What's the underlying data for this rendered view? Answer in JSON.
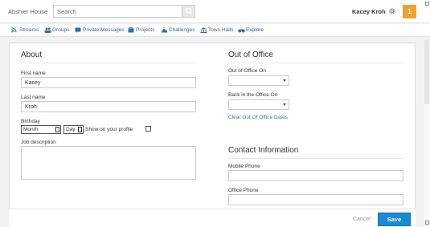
{
  "topbar": {
    "brand": "Abshier House",
    "search_placeholder": "Search",
    "user_name": "Kacey Kroh",
    "notification_count": "1"
  },
  "nav": {
    "items": [
      {
        "label": "Streams",
        "icon": "streams-icon"
      },
      {
        "label": "Groups",
        "icon": "groups-icon"
      },
      {
        "label": "Private Messages",
        "icon": "message-icon"
      },
      {
        "label": "Projects",
        "icon": "projects-icon"
      },
      {
        "label": "Challenges",
        "icon": "challenges-icon"
      },
      {
        "label": "Town Halls",
        "icon": "town-hall-icon"
      },
      {
        "label": "Explore",
        "icon": "binoculars-icon"
      }
    ]
  },
  "about": {
    "title": "About",
    "first_name_label": "First name",
    "first_name_value": "Kacey",
    "last_name_label": "Last name",
    "last_name_value": "Kroh",
    "birthday_label": "Birthday",
    "month_value": "Month",
    "day_value": "Day",
    "show_on_profile_label": "Show on your profile",
    "job_description_label": "Job description"
  },
  "out_of_office": {
    "title": "Out of Office",
    "on_label": "Out of Office On",
    "back_label": "Back in the Office On",
    "clear_link": "Clear Out Of Office Dates"
  },
  "contact": {
    "title": "Contact Information",
    "mobile_label": "Mobile Phone",
    "office_label": "Office Phone"
  },
  "footer": {
    "cancel_label": "Cancel",
    "save_label": "Save"
  },
  "colors": {
    "accent": "#1a8ad4",
    "notification": "#f0a030",
    "link": "#2a7ab8"
  }
}
